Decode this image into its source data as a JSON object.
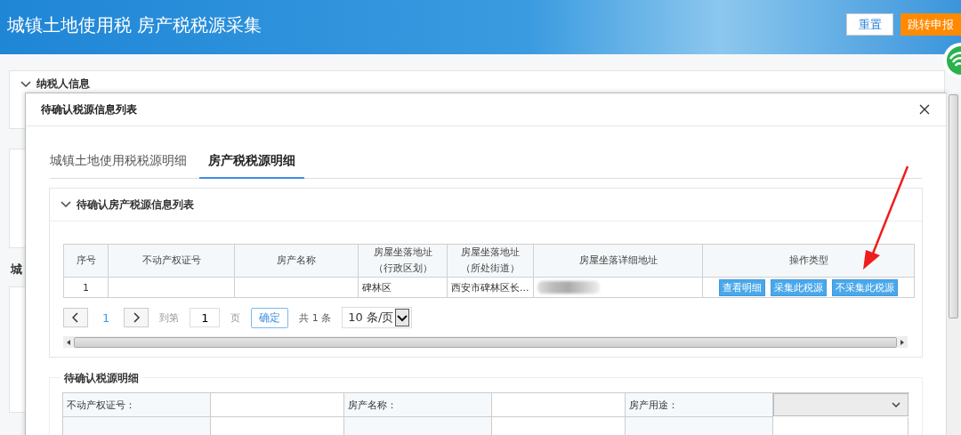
{
  "header": {
    "title": "城镇土地使用税 房产税税源采集",
    "buttons": [
      {
        "label": "重置",
        "kind": "secondary"
      },
      {
        "label": "跳转申报",
        "kind": "primary"
      }
    ]
  },
  "background": {
    "section_title": "纳税人信息",
    "tab_fragment": "城"
  },
  "dialog": {
    "title": "待确认税源信息列表",
    "tabs": [
      {
        "label": "城镇土地使用税税源明细",
        "selected": false
      },
      {
        "label": "房产税税源明细",
        "selected": true
      }
    ],
    "list_section": {
      "title": "待确认房产税源信息列表",
      "columns": [
        {
          "lines": [
            "序号"
          ]
        },
        {
          "lines": [
            "不动产权证号"
          ]
        },
        {
          "lines": [
            "房产名称"
          ]
        },
        {
          "lines": [
            "房屋坐落地址",
            "（行政区划）"
          ]
        },
        {
          "lines": [
            "房屋坐落地址",
            "（所处街道）"
          ]
        },
        {
          "lines": [
            "房屋坐落详细地址"
          ]
        },
        {
          "lines": [
            "操作类型"
          ]
        }
      ],
      "rows": [
        {
          "cells": [
            {
              "kind": "index",
              "text": "1"
            },
            {
              "kind": "empty"
            },
            {
              "kind": "empty"
            },
            {
              "kind": "text",
              "text": "碑林区"
            },
            {
              "kind": "text",
              "text": "西安市碑林区长..."
            },
            {
              "kind": "redacted"
            },
            {
              "kind": "actions",
              "buttons": [
                "查看明细",
                "采集此税源",
                "不采集此税源"
              ]
            }
          ]
        }
      ],
      "pagination": {
        "pages": [
          {
            "label": "1",
            "selected": true
          }
        ],
        "goto_label": "到第",
        "goto_value": "1",
        "page_unit": "页",
        "confirm": "确定",
        "total": "共 1 条",
        "page_size": "10 条/页"
      }
    },
    "detail_section": {
      "title": "待确认税源明细",
      "fields": [
        {
          "label": "不动产权证号：",
          "kind": "input"
        },
        {
          "label": "房产名称：",
          "kind": "input"
        },
        {
          "label": "房产用途：",
          "kind": "select"
        }
      ]
    }
  }
}
